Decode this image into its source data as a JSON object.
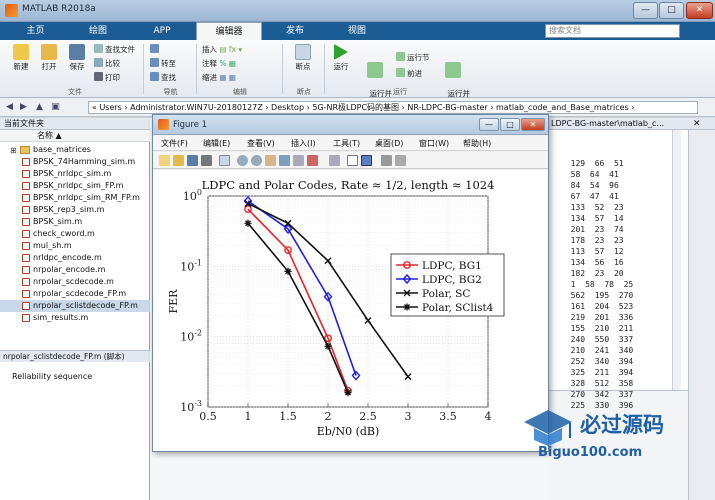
{
  "app": {
    "title": "MATLAB R2018a",
    "window_buttons": {
      "min": "—",
      "max": "□",
      "close": "✕"
    }
  },
  "tabs": [
    "主页",
    "绘图",
    "APP",
    "编辑器",
    "发布",
    "视图"
  ],
  "active_tab": "编辑器",
  "search": {
    "placeholder": "搜索文档"
  },
  "ribbon": {
    "file": {
      "new": "新建",
      "open": "打开",
      "save": "保存",
      "find_files": "查找文件",
      "compare": "比较",
      "print": "打印",
      "group": "文件"
    },
    "nav": {
      "goto": "转至",
      "find": "查找",
      "group": "导航"
    },
    "edit": {
      "insert": "插入",
      "comment": "注释",
      "indent": "缩进",
      "group": "编辑"
    },
    "breakpoints": {
      "label": "断点",
      "group": "断点"
    },
    "run": {
      "run": "运行",
      "run_advance": "运行并\n前进",
      "run_section": "运行节",
      "advance": "前进",
      "run_time": "运行并\n计时",
      "group": "运行"
    }
  },
  "address": {
    "path": "«  Users  ›  Administrator.WIN7U-20180127Z  ›  Desktop  ›  5G-NR极LDPC码的基图  ›  NR-LDPC-BG-master  ›  matlab_code_and_Base_matrices  ›"
  },
  "left_panel": {
    "header": "当前文件夹",
    "column": "名称 ▲",
    "files": [
      "base_matrices",
      "BPSK_74Hamming_sim.m",
      "BPSK_nrldpc_sim.m",
      "BPSK_nrldpc_sim_FP.m",
      "BPSK_nrldpc_sim_RM_FP.m",
      "BPSK_rep3_sim.m",
      "BPSK_sim.m",
      "check_cword.m",
      "mul_sh.m",
      "nrldpc_encode.m",
      "nrpolar_encode.m",
      "nrpolar_scdecode.m",
      "nrpolar_scdecode_FP.m",
      "nrpolar_sclistdecode_FP.m",
      "sim_results.m"
    ],
    "selected_index": 13,
    "detail_header": "nrpolar_sclistdecode_FP.m  (脚本)",
    "detail_text": "Reliability sequence"
  },
  "right_panel": {
    "header": "LDPC-BG-master\\matlab_c...",
    "close": "✕",
    "rows": [
      "  129  66  51",
      "  58  64  41",
      "  84  54  96",
      "  67  47  41",
      "  133  52  23",
      "  134  57  14",
      "  201  23  74",
      "  178  23  23",
      "  113  57  12",
      "  134  56  16",
      "  182  23  20",
      "  1  58  78  25",
      "  562  195  270",
      "  161  204  523",
      "  219  201  336",
      "  155  210  211",
      "  240  550  337",
      "  210  241  340",
      "  252  340  394",
      "  325  211  394",
      "  328  512  358",
      "  270  342  337",
      "  225  330  396"
    ]
  },
  "figure": {
    "title": "Figure 1",
    "menu": [
      "文件(F)",
      "编辑(E)",
      "查看(V)",
      "插入(I)",
      "工具(T)",
      "桌面(D)",
      "窗口(W)",
      "帮助(H)"
    ]
  },
  "chart_data": {
    "type": "line",
    "title": "LDPC and Polar Codes, Rate ≈ 1/2, length ≈ 1024",
    "xlabel": "Eb/N0 (dB)",
    "ylabel": "FER",
    "xlim": [
      0.5,
      4
    ],
    "ylim": [
      0.001,
      1
    ],
    "yscale": "log",
    "xticks": [
      "0.5",
      "1",
      "1.5",
      "2",
      "2.5",
      "3",
      "3.5",
      "4"
    ],
    "yticks": [
      "10^0",
      "10^-1",
      "10^-2",
      "10^-3"
    ],
    "grid": true,
    "legend_position": "top-right",
    "series": [
      {
        "name": "LDPC, BG1",
        "color": "#e8242a",
        "marker": "circle",
        "x": [
          1,
          1.5,
          2,
          2.25
        ],
        "y": [
          0.65,
          0.17,
          0.0095,
          0.0017
        ]
      },
      {
        "name": "LDPC, BG2",
        "color": "#1f1fe0",
        "marker": "diamond",
        "x": [
          1,
          1.5,
          2,
          2.35
        ],
        "y": [
          0.85,
          0.34,
          0.037,
          0.0028
        ]
      },
      {
        "name": "Polar, SC",
        "color": "#111111",
        "marker": "x",
        "x": [
          1,
          1.5,
          2,
          2.5,
          3
        ],
        "y": [
          0.78,
          0.41,
          0.12,
          0.017,
          0.0027
        ]
      },
      {
        "name": "Polar, SClist4",
        "color": "#111111",
        "marker": "star",
        "x": [
          1,
          1.5,
          2,
          2.25
        ],
        "y": [
          0.41,
          0.085,
          0.0073,
          0.0016
        ]
      }
    ]
  },
  "watermark": {
    "cn": "必过源码",
    "url": "Biguo100.com"
  }
}
